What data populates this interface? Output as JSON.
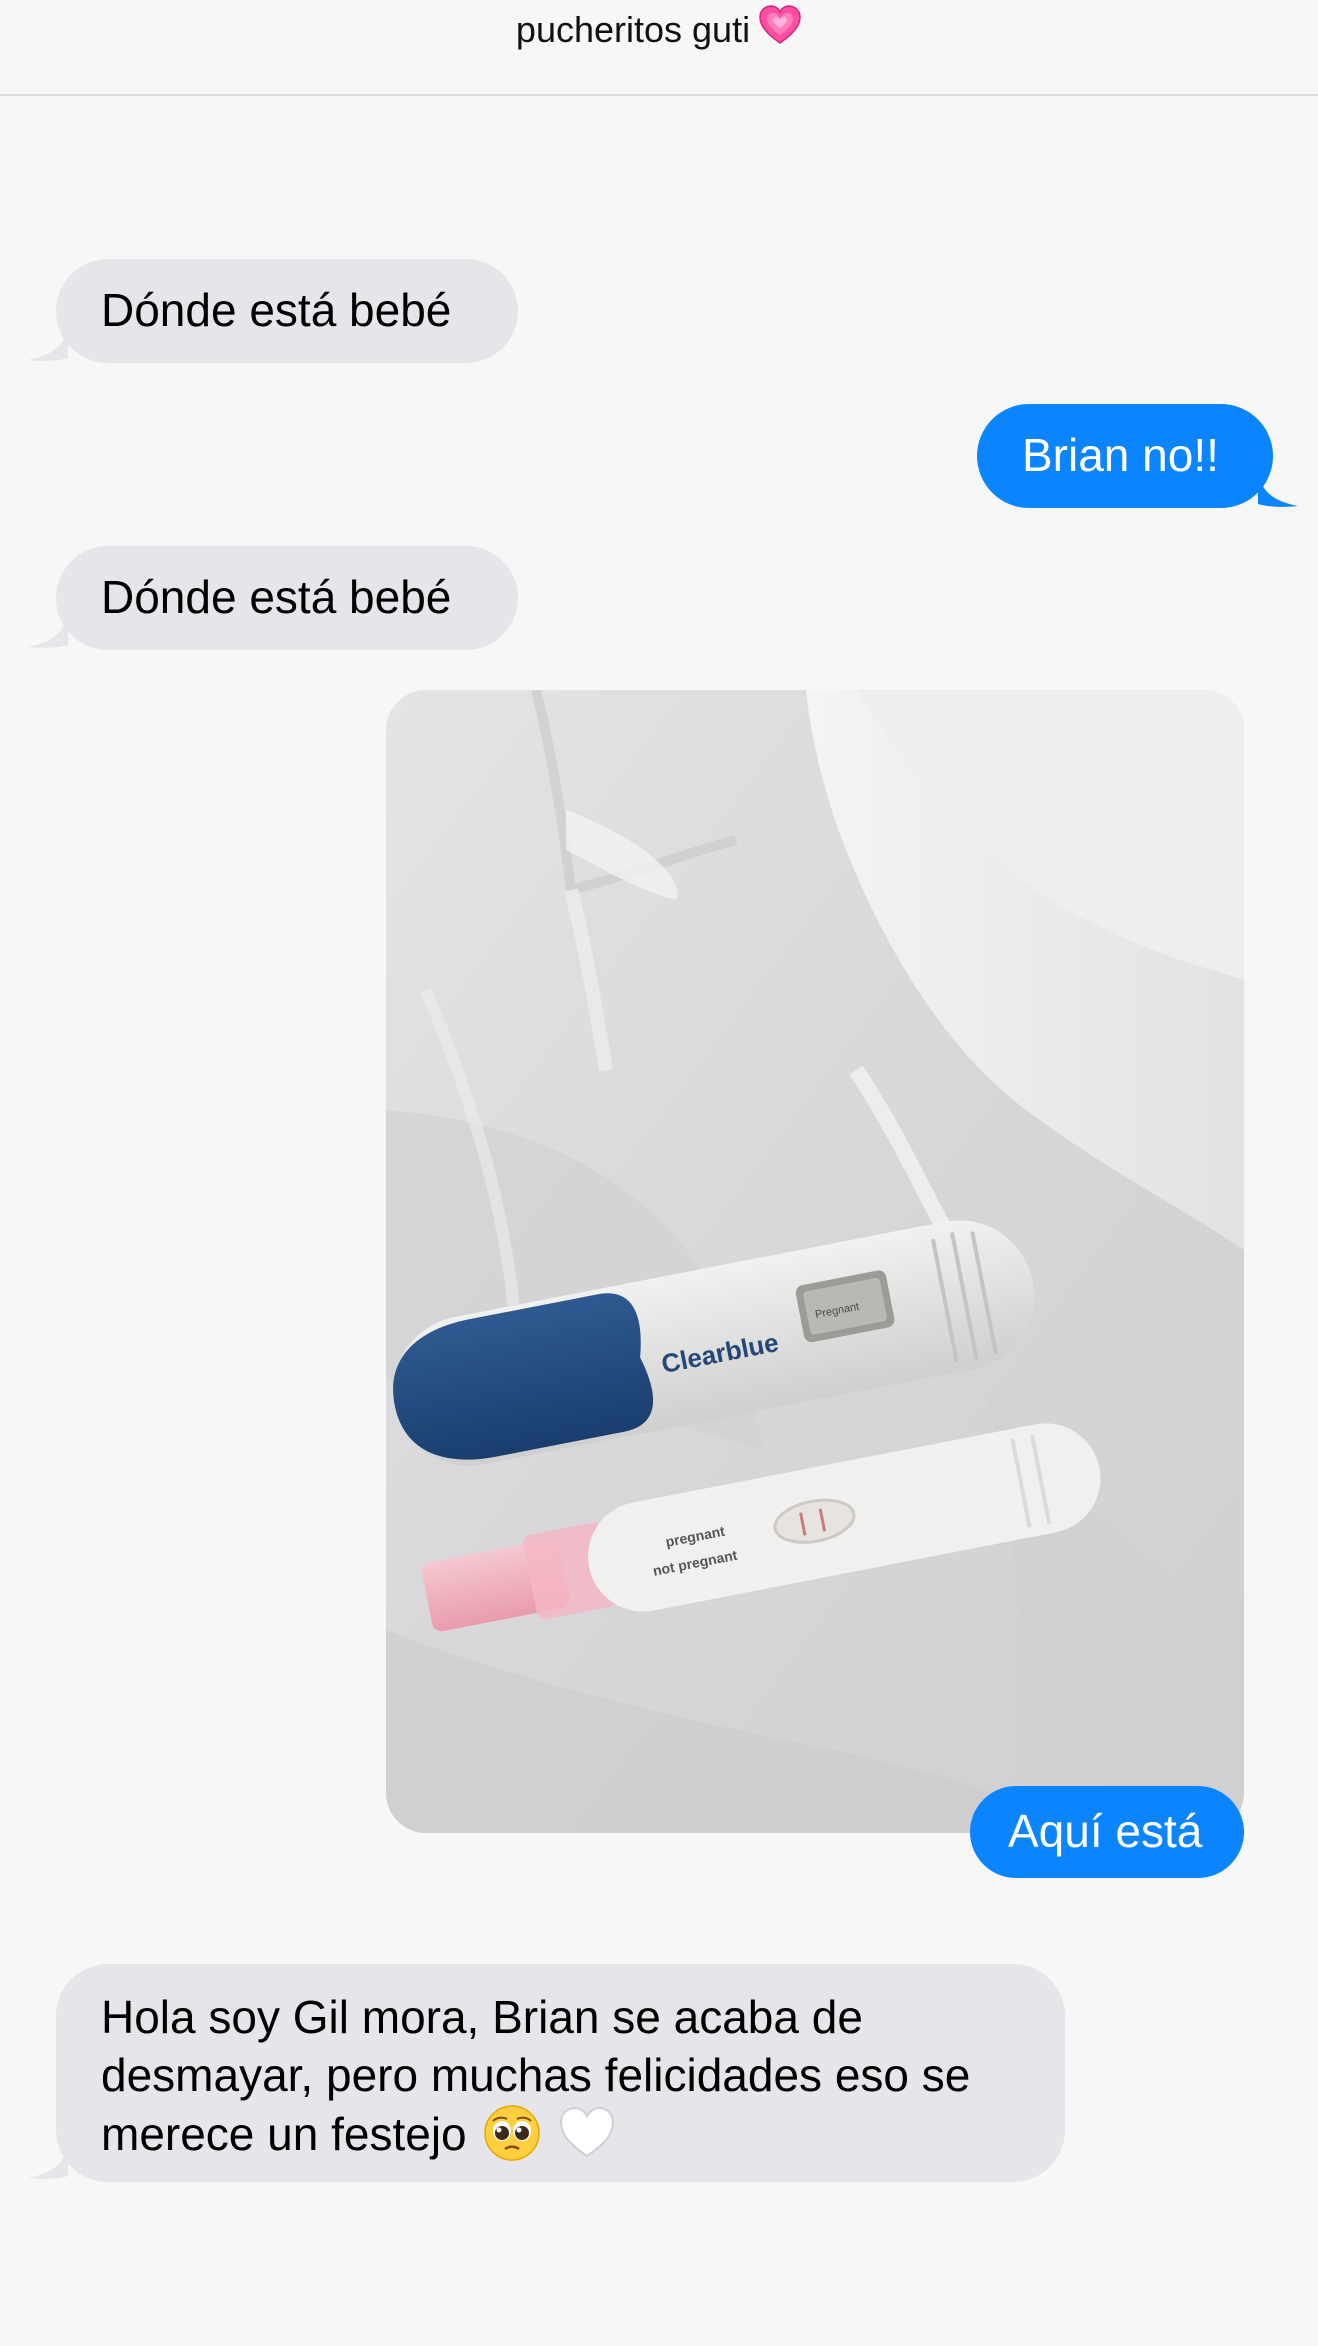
{
  "header": {
    "title": "pucheritos guti",
    "title_emoji": "growing-heart-emoji"
  },
  "messages": [
    {
      "side": "received",
      "text": "Dónde está bebé"
    },
    {
      "side": "sent",
      "text": "Brian no!!"
    },
    {
      "side": "received",
      "text": "Dónde está bebé"
    },
    {
      "side": "sent",
      "type": "photo",
      "description_icon": "photo-pregnancy-tests"
    },
    {
      "side": "sent",
      "text": "Aquí está"
    },
    {
      "side": "received",
      "text": "Hola soy Gil mora, Brian se acaba de desmayar, pero muchas felicidades eso se merece un festejo",
      "trailing_emojis": [
        "pleading-face-emoji",
        "white-heart-emoji"
      ]
    }
  ],
  "photo": {
    "brand_text": "Clearblue",
    "display_text": "Pregnant",
    "test_label_1": "pregnant",
    "test_label_2": "not pregnant"
  },
  "colors": {
    "sent_bubble": "#0a84ff",
    "received_bubble": "#e5e5ea",
    "background": "#f7f7f8"
  }
}
